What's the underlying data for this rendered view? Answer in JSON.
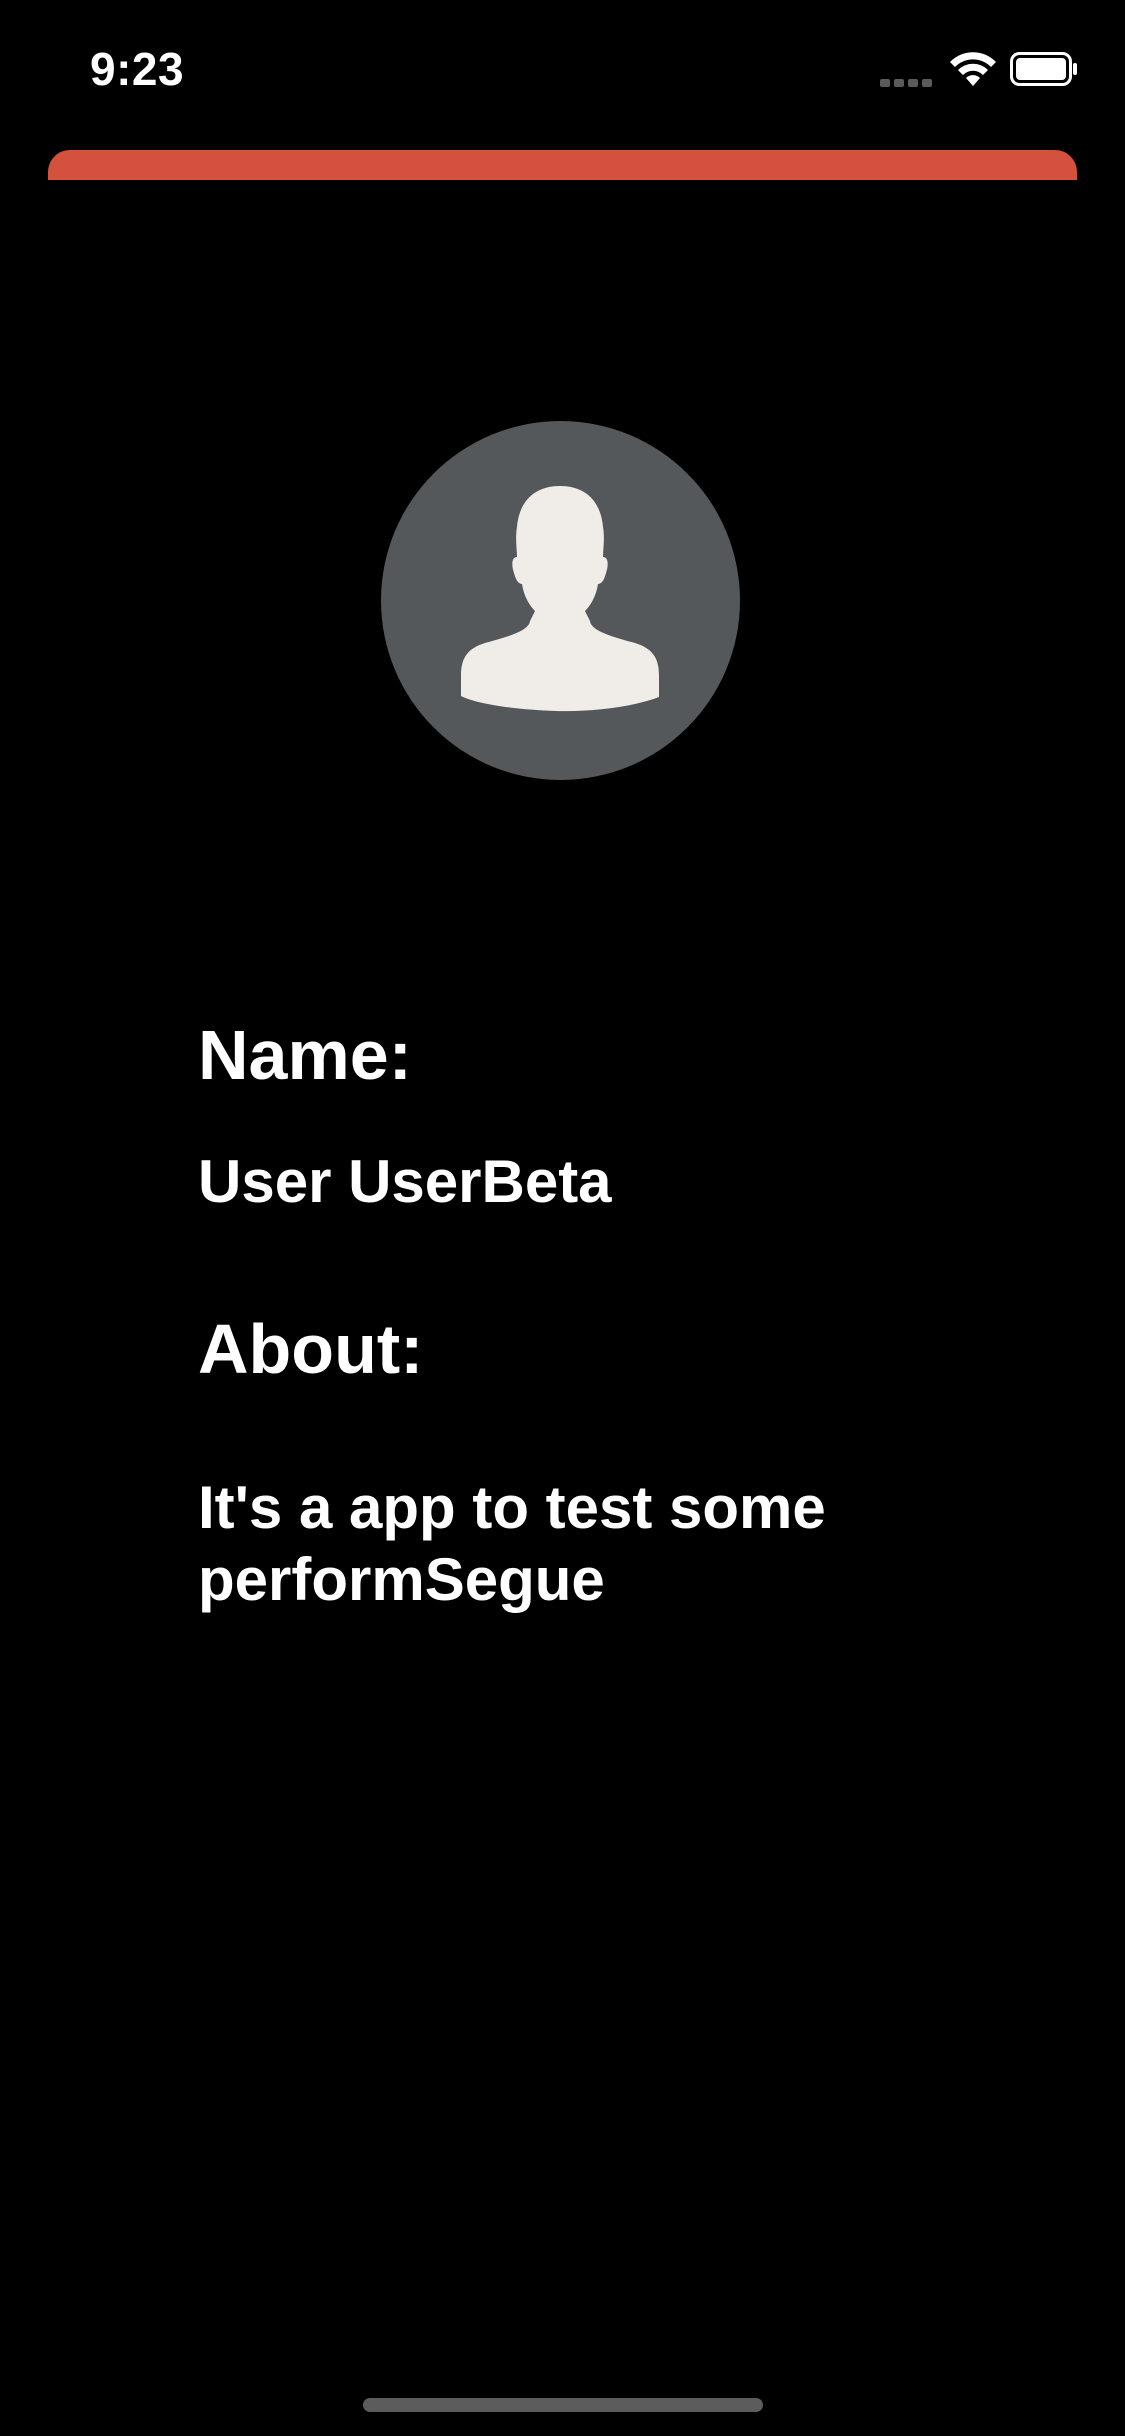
{
  "status_bar": {
    "time": "9:23",
    "signal_icon": "cellular-signal-icon",
    "wifi_icon": "wifi-icon",
    "battery_icon": "battery-icon"
  },
  "colors": {
    "accent": "#d4523d",
    "background": "#000000",
    "avatar_background": "#55585b",
    "avatar_figure": "#f0ece8",
    "text": "#ffffff"
  },
  "profile": {
    "avatar_icon": "person-silhouette-icon",
    "name_label": "Name:",
    "name_value": "User UserBeta",
    "about_label": "About:",
    "about_value": "It's a app to test some performSegue"
  }
}
